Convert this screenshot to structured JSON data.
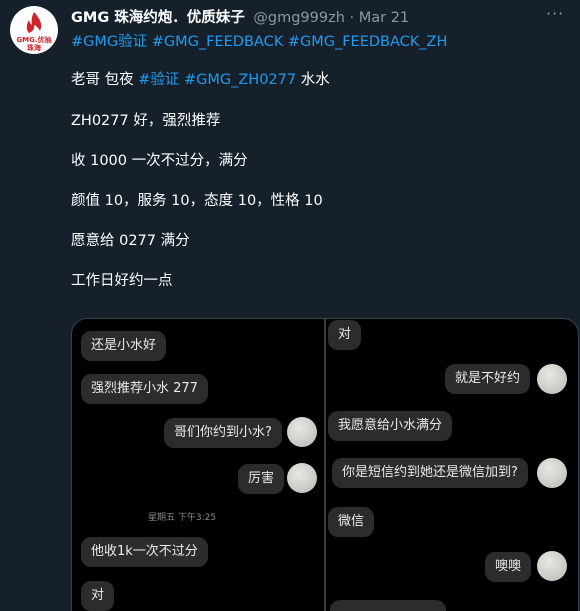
{
  "tweet": {
    "avatar_label": "GMG.优抽\n珠海",
    "display_name": "GMG 珠海约炮．优质妹子",
    "handle": "@gmg999zh",
    "separator": " · ",
    "date": "Mar 21",
    "more_icon": "···",
    "hashtags": "#GMG验证 #GMG_FEEDBACK #GMG_FEEDBACK_ZH",
    "line1_prefix": "老哥 包夜 ",
    "line1_links": "#验证 #GMG_ZH0277",
    "line1_suffix": " 水水",
    "line2": "ZH0277 好，强烈推荐",
    "line3": "收 1000 一次不过分，满分",
    "line4": "颜值 10，服务 10，态度 10，性格 10",
    "line5": "愿意给 0277 满分",
    "line6": "工作日好约一点"
  },
  "media": {
    "left_chat": {
      "msg1": "还是小水好",
      "msg2": "强烈推荐小水 277",
      "msg3": "哥们你约到小水?",
      "msg4": "厉害",
      "timestamp": "星期五 下午3:25",
      "msg5": "他收1k一次不过分",
      "msg6": "对"
    },
    "right_chat": {
      "msg1": "对",
      "msg2": "就是不好约",
      "msg3": "我愿意给小水满分",
      "msg4": "你是短信约到她还是微信加到?",
      "msg5": "微信",
      "msg6": "噢噢"
    }
  }
}
